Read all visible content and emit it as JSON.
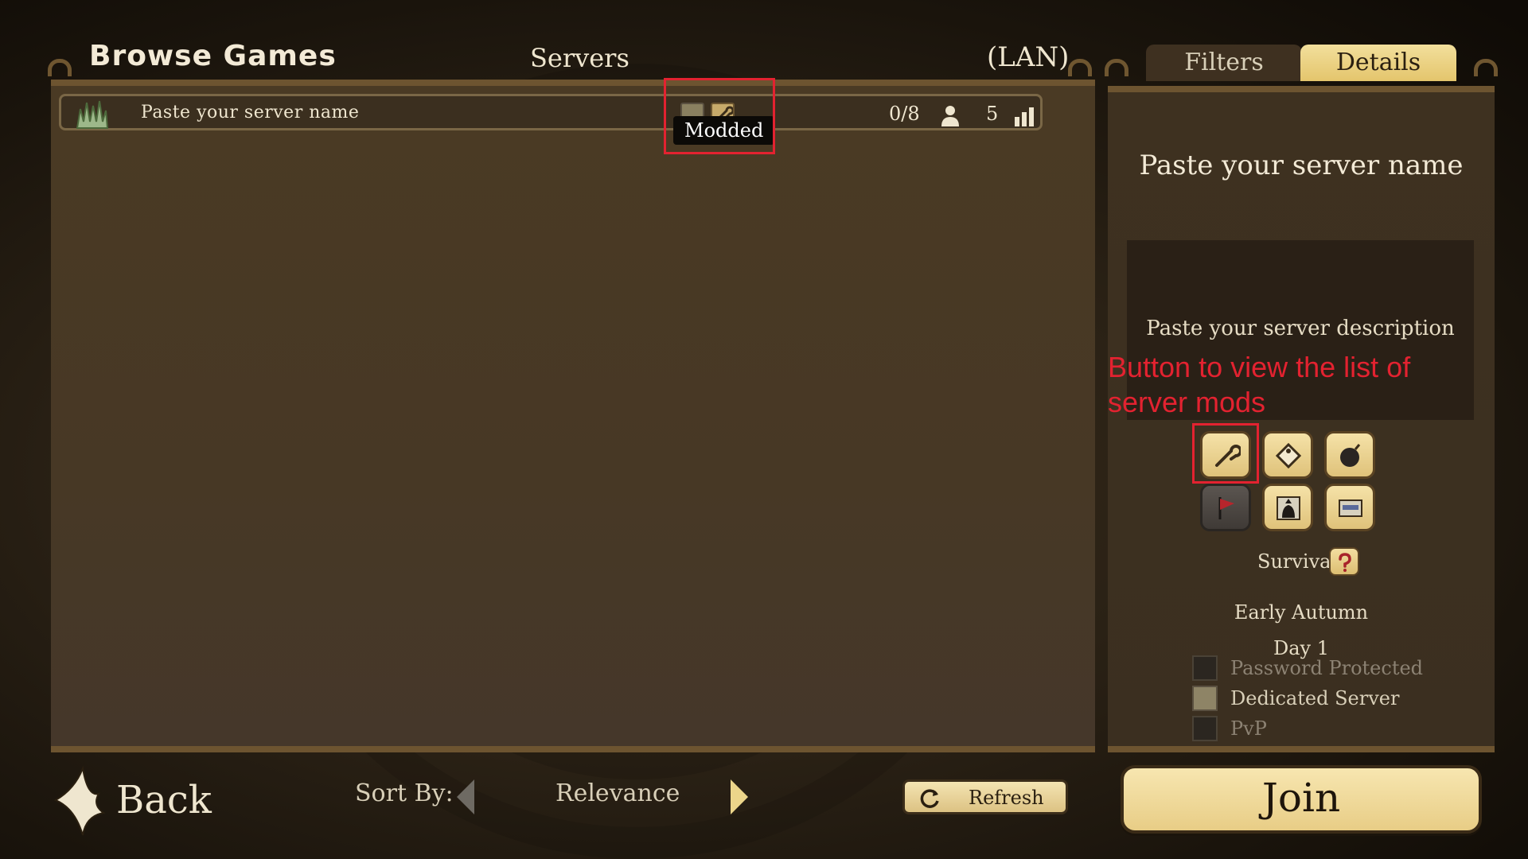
{
  "header": {
    "title": "Browse Games",
    "list_heading": "Servers",
    "network": "(LAN)"
  },
  "server_list": {
    "rows": [
      {
        "name": "Paste your server name",
        "players": "0/8",
        "ping": "5",
        "tags": [
          "dedicated-server-icon",
          "wrench-icon"
        ]
      }
    ],
    "tooltip": "Modded"
  },
  "tabs": {
    "filters": "Filters",
    "details": "Details"
  },
  "details": {
    "server_name": "Paste your server name",
    "description": "Paste your server description",
    "annotation": "Button to view the list of server mods",
    "icon_buttons": [
      "wrench-icon",
      "tag-icon",
      "bomb-icon",
      "flag-icon",
      "character-icon",
      "settings-icon"
    ],
    "game_mode": "Survival",
    "season": "Early Autumn",
    "day": "Day 1",
    "checks": {
      "password": "Password Protected",
      "dedicated": "Dedicated Server",
      "pvp": "PvP"
    }
  },
  "bottom": {
    "back": "Back",
    "sort_label": "Sort By:",
    "sort_value": "Relevance",
    "refresh": "Refresh",
    "join": "Join"
  },
  "colors": {
    "accent_gold": "#e8cd86",
    "annotation_red": "#e32230",
    "panel_brown": "#4a3a24"
  }
}
